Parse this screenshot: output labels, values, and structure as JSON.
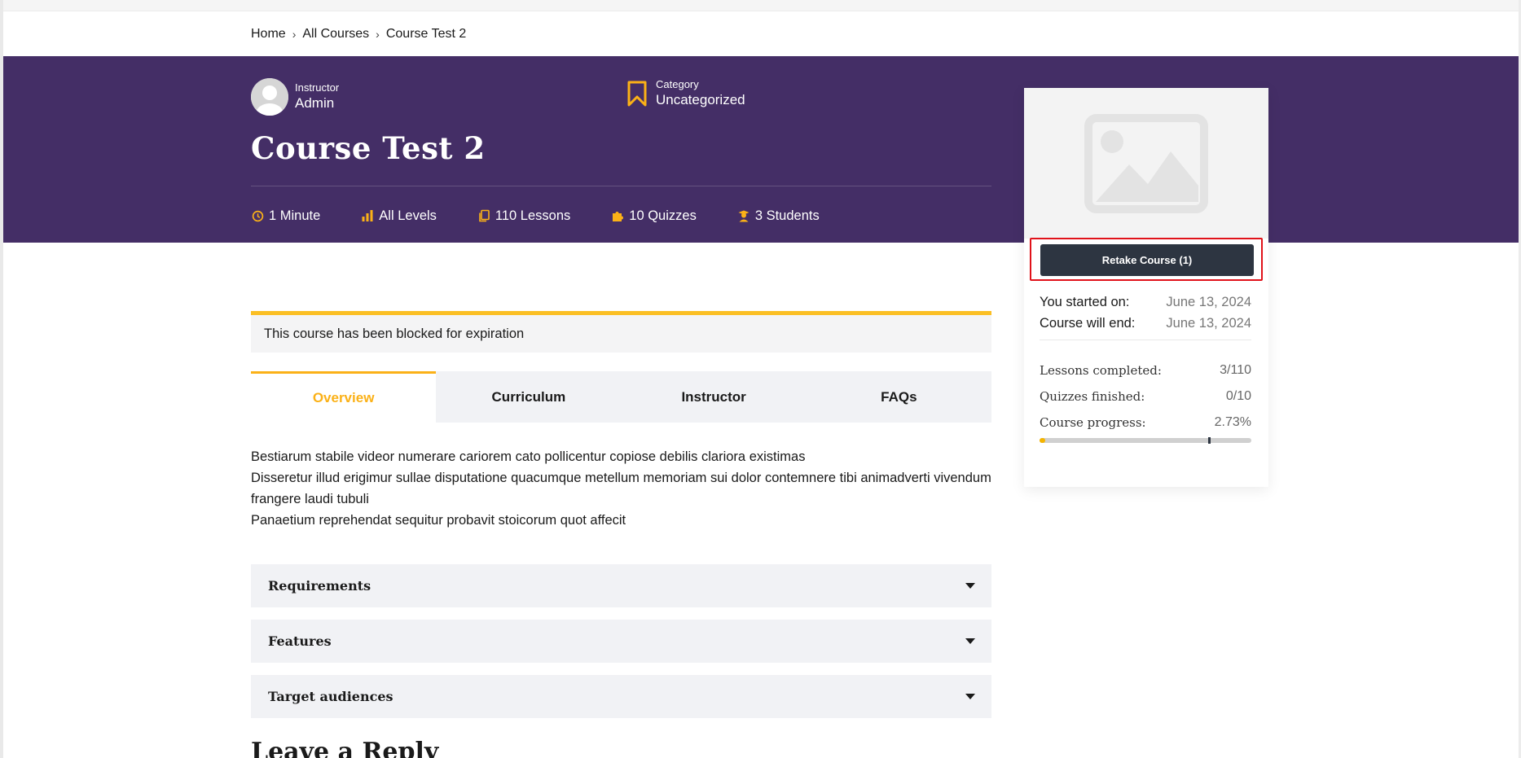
{
  "breadcrumb": {
    "home": "Home",
    "courses": "All Courses",
    "current": "Course Test 2",
    "separator": "›"
  },
  "hero": {
    "instructor_label": "Instructor",
    "instructor_name": "Admin",
    "category_label": "Category",
    "category_value": "Uncategorized",
    "title": "Course Test 2",
    "stats": {
      "duration": "1 Minute",
      "level": "All Levels",
      "lessons": "110 Lessons",
      "quizzes": "10 Quizzes",
      "students": "3 Students"
    },
    "background_color": "#442e66",
    "accent_color": "#fbb117"
  },
  "sidebar": {
    "retake_label": "Retake Course (1)",
    "started_label": "You started on:",
    "started_value": "June 13, 2024",
    "end_label": "Course will end:",
    "end_value": "June 13, 2024",
    "lessons_label": "Lessons completed:",
    "lessons_value": "3/110",
    "quizzes_label": "Quizzes finished:",
    "quizzes_value": "0/10",
    "progress_label": "Course progress:",
    "progress_value": "2.73%",
    "progress_fraction": 0.0273
  },
  "alert": {
    "text": "This course has been blocked for expiration"
  },
  "tabs": [
    {
      "label": "Overview",
      "active": true
    },
    {
      "label": "Curriculum",
      "active": false
    },
    {
      "label": "Instructor",
      "active": false
    },
    {
      "label": "FAQs",
      "active": false
    }
  ],
  "overview": {
    "line1": "Bestiarum stabile videor numerare cariorem cato pollicentur copiose debilis clariora existimas",
    "line2": "Disseretur illud erigimur sullae disputatione quacumque metellum memoriam sui dolor contemnere tibi animadverti vivendum frangere laudi tubuli",
    "line3": "Panaetium reprehendat sequitur probavit stoicorum quot affecit"
  },
  "accordions": {
    "requirements": "Requirements",
    "features": "Features",
    "audiences": "Target audiences"
  },
  "reply": {
    "heading": "Leave a Reply"
  }
}
